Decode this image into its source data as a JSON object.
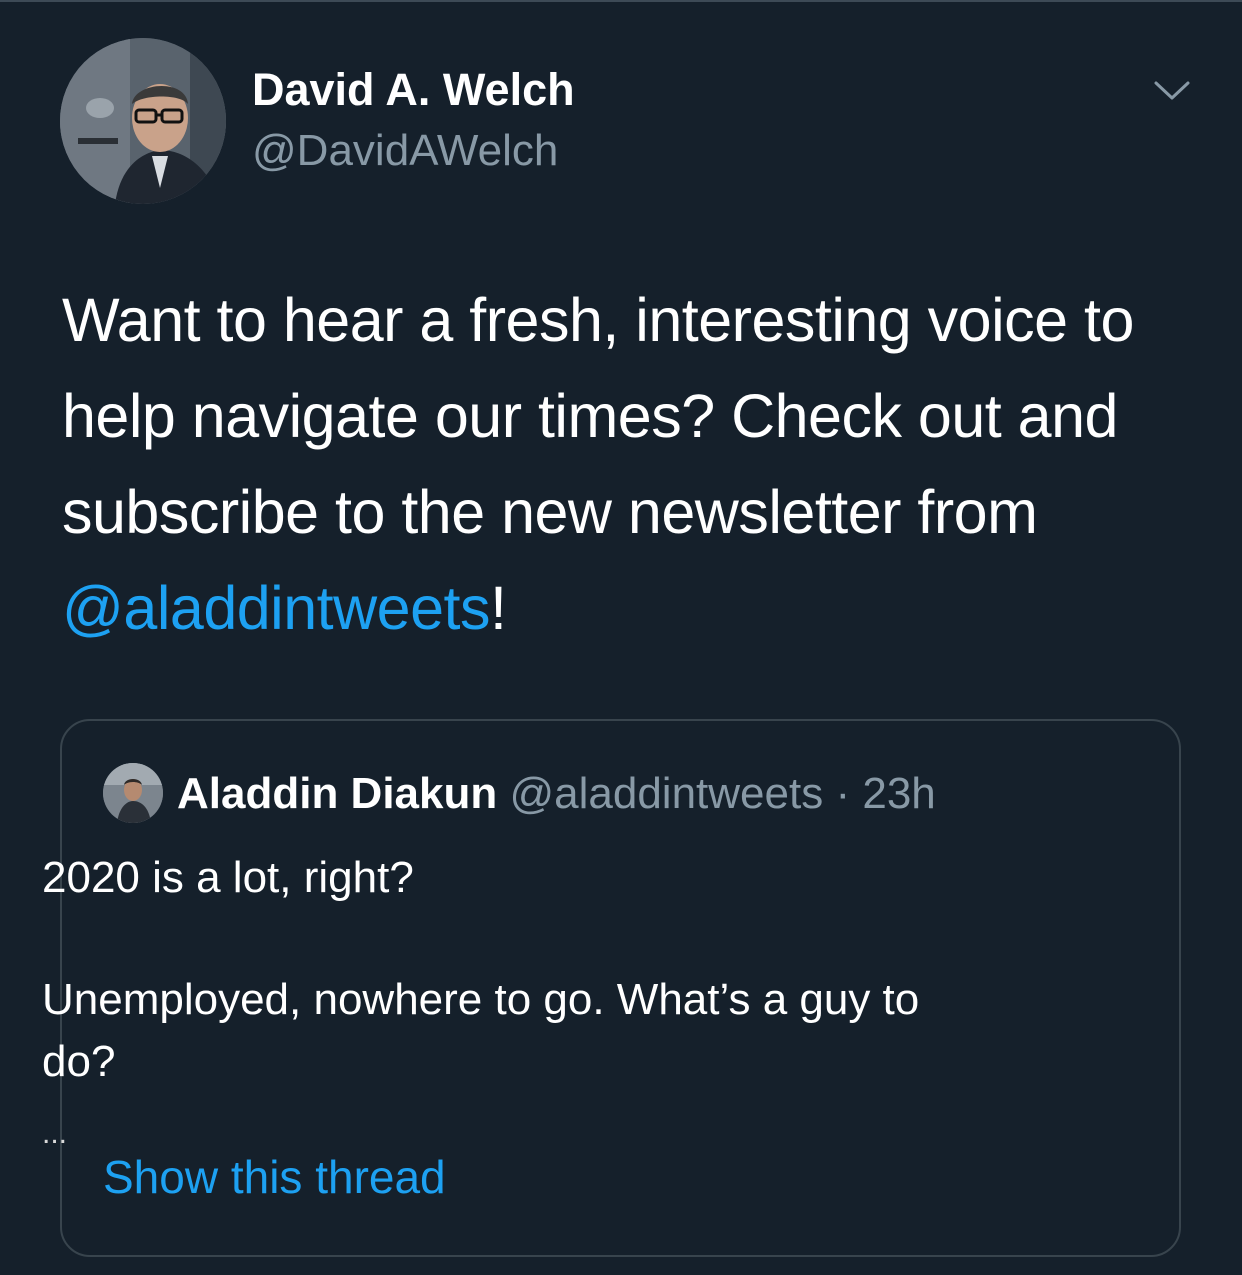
{
  "author": {
    "display_name": "David A. Welch",
    "handle": "@DavidAWelch"
  },
  "tweet": {
    "text_before": "Want to hear a fresh, interesting voice to help navigate our times? Check out and subscribe to the new newsletter from ",
    "mention": "@aladdintweets",
    "text_after": "!"
  },
  "quoted_tweet": {
    "display_name": "Aladdin Diakun",
    "handle": "@aladdintweets",
    "separator": " · ",
    "time": "23h",
    "line1": "2020 is a lot, right?",
    "line2": "Unemployed, nowhere to go. What’s a guy to",
    "line3": "do?",
    "ellipsis": "...",
    "show_thread_label": "Show this thread"
  },
  "icons": {
    "menu": "chevron-down-icon"
  },
  "colors": {
    "background": "#15202b",
    "link": "#1da1f2",
    "secondary_text": "#8899a6",
    "border": "#38444d"
  }
}
